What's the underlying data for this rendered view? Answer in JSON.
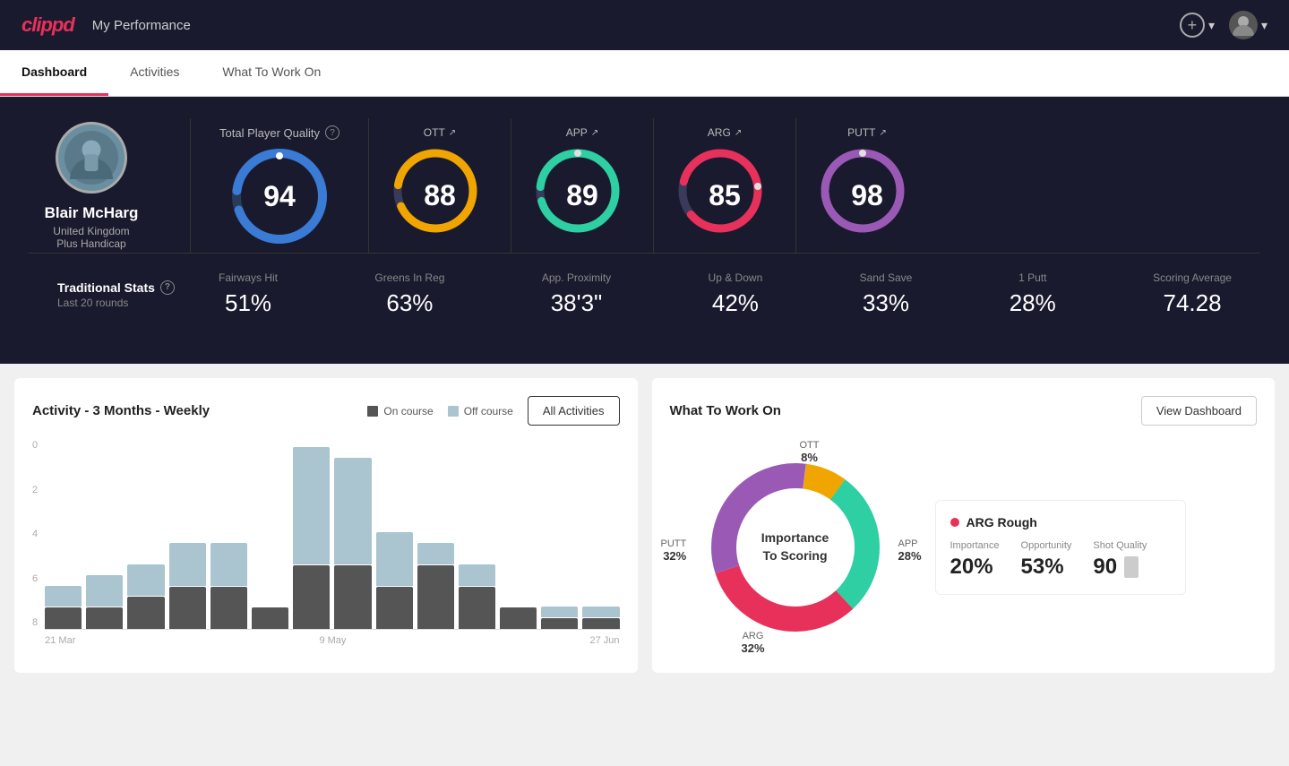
{
  "header": {
    "logo": "clippd",
    "title": "My Performance",
    "add_label": "+",
    "chevron_down": "▾"
  },
  "tabs": [
    {
      "id": "dashboard",
      "label": "Dashboard",
      "active": true
    },
    {
      "id": "activities",
      "label": "Activities",
      "active": false
    },
    {
      "id": "what-to-work-on",
      "label": "What To Work On",
      "active": false
    }
  ],
  "hero": {
    "profile": {
      "name": "Blair McHarg",
      "country": "United Kingdom",
      "handicap": "Plus Handicap"
    },
    "tpq": {
      "label": "Total Player Quality",
      "score": 94,
      "color": "#3a7bd5",
      "bg_color": "#2a2a4a"
    },
    "scores": [
      {
        "label": "OTT",
        "value": 88,
        "color": "#f0a500",
        "track": "#3a3a5a"
      },
      {
        "label": "APP",
        "value": 89,
        "color": "#2ecfa3",
        "track": "#3a3a5a"
      },
      {
        "label": "ARG",
        "value": 85,
        "color": "#e8315a",
        "track": "#3a3a5a"
      },
      {
        "label": "PUTT",
        "value": 98,
        "color": "#9b59b6",
        "track": "#3a3a5a"
      }
    ]
  },
  "trad_stats": {
    "label": "Traditional Stats",
    "sublabel": "Last 20 rounds",
    "items": [
      {
        "label": "Fairways Hit",
        "value": "51%"
      },
      {
        "label": "Greens In Reg",
        "value": "63%"
      },
      {
        "label": "App. Proximity",
        "value": "38'3\""
      },
      {
        "label": "Up & Down",
        "value": "42%"
      },
      {
        "label": "Sand Save",
        "value": "33%"
      },
      {
        "label": "1 Putt",
        "value": "28%"
      },
      {
        "label": "Scoring Average",
        "value": "74.28"
      }
    ]
  },
  "activity_chart": {
    "title": "Activity - 3 Months - Weekly",
    "legend": [
      {
        "label": "On course",
        "color": "#555"
      },
      {
        "label": "Off course",
        "color": "#aac4d0"
      }
    ],
    "all_button": "All Activities",
    "y_labels": [
      "0",
      "2",
      "4",
      "6",
      "8"
    ],
    "x_labels": [
      "21 Mar",
      "9 May",
      "27 Jun"
    ],
    "bars": [
      {
        "on": 1,
        "off": 1
      },
      {
        "on": 1,
        "off": 1.5
      },
      {
        "on": 1.5,
        "off": 1.5
      },
      {
        "on": 2,
        "off": 2
      },
      {
        "on": 2,
        "off": 2
      },
      {
        "on": 1,
        "off": 0
      },
      {
        "on": 3,
        "off": 5.5
      },
      {
        "on": 3,
        "off": 5
      },
      {
        "on": 2,
        "off": 2.5
      },
      {
        "on": 3,
        "off": 1
      },
      {
        "on": 2,
        "off": 1
      },
      {
        "on": 1,
        "off": 0
      },
      {
        "on": 0.5,
        "off": 0.5
      },
      {
        "on": 0.5,
        "off": 0.5
      }
    ]
  },
  "what_to_work_on": {
    "title": "What To Work On",
    "view_btn": "View Dashboard",
    "donut_center": "Importance\nTo Scoring",
    "segments": [
      {
        "label": "OTT",
        "pct": "8%",
        "color": "#f0a500",
        "angle_start": 0,
        "angle_end": 28.8
      },
      {
        "label": "APP",
        "pct": "28%",
        "color": "#2ecfa3",
        "angle_start": 28.8,
        "angle_end": 129.6
      },
      {
        "label": "ARG",
        "pct": "32%",
        "color": "#e8315a",
        "angle_start": 129.6,
        "angle_end": 244.8
      },
      {
        "label": "PUTT",
        "pct": "32%",
        "color": "#9b59b6",
        "angle_start": 244.8,
        "angle_end": 360
      }
    ],
    "info_card": {
      "dot_color": "#e8315a",
      "title": "ARG Rough",
      "metrics": [
        {
          "label": "Importance",
          "value": "20%"
        },
        {
          "label": "Opportunity",
          "value": "53%"
        },
        {
          "label": "Shot Quality",
          "value": "90"
        }
      ]
    }
  }
}
